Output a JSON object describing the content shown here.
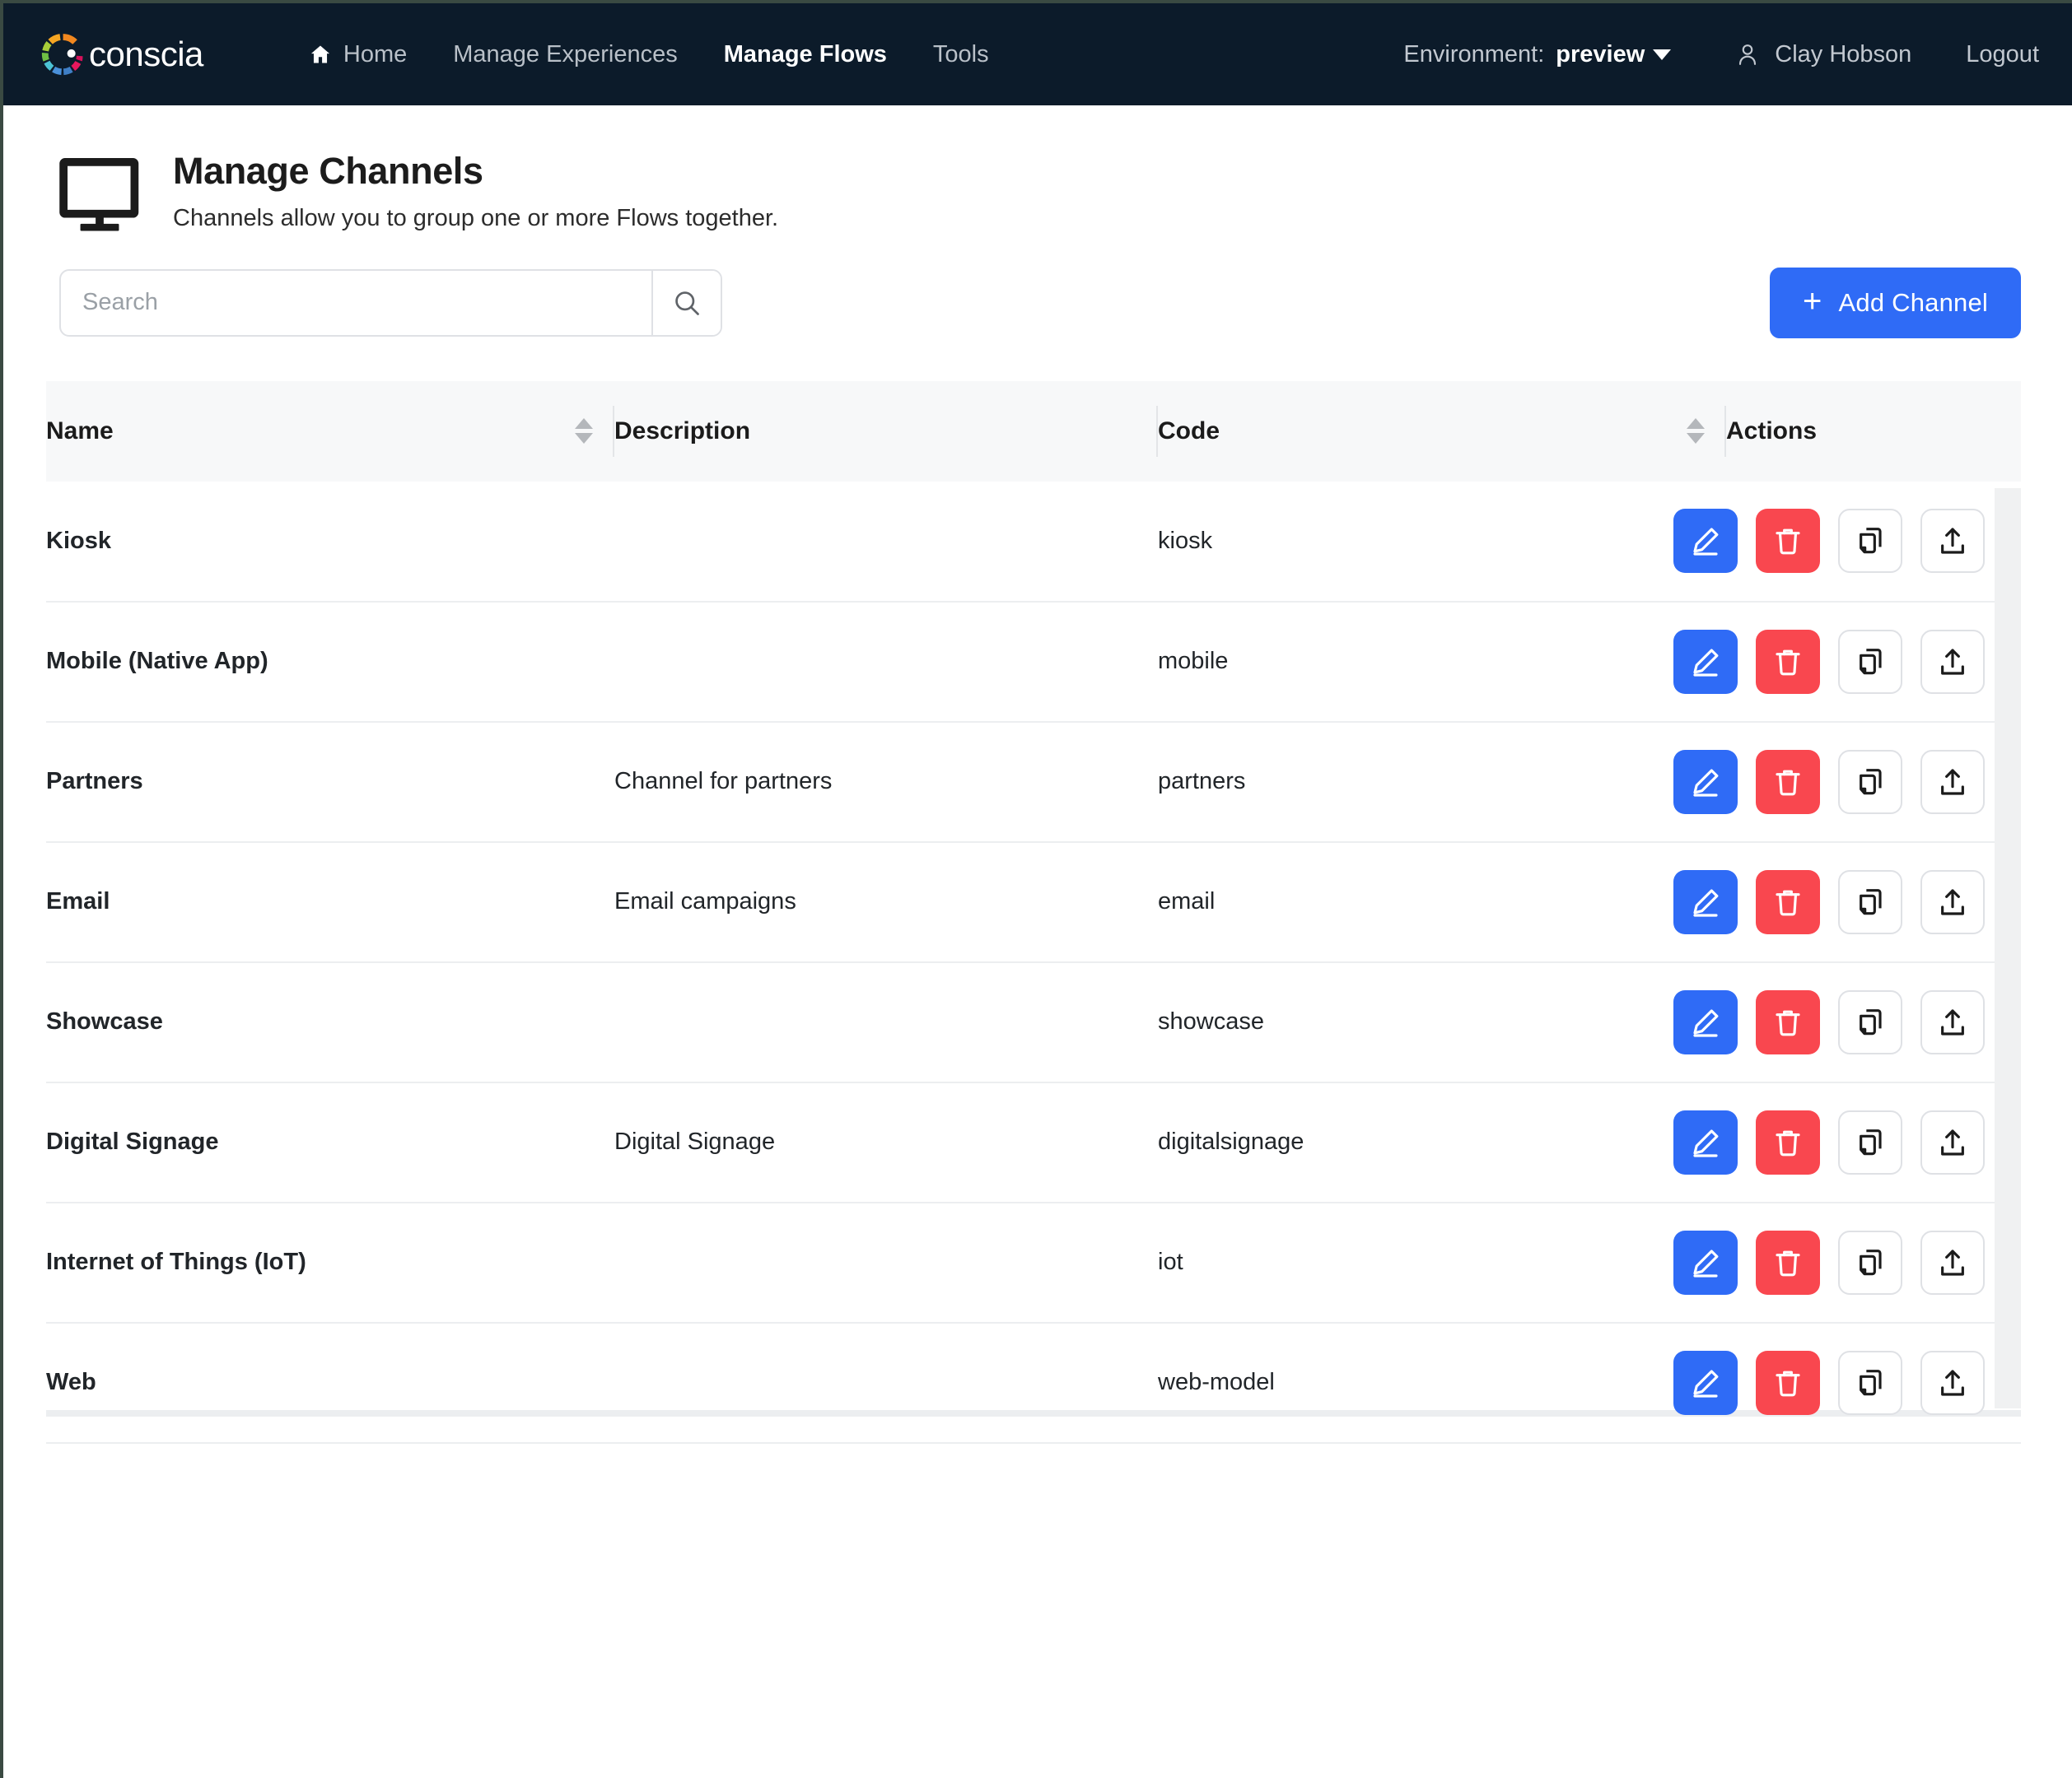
{
  "navbar": {
    "brand": "conscia",
    "links": [
      {
        "label": "Home",
        "icon": "home-icon",
        "active": false
      },
      {
        "label": "Manage Experiences",
        "icon": null,
        "active": false
      },
      {
        "label": "Manage Flows",
        "icon": null,
        "active": true
      },
      {
        "label": "Tools",
        "icon": null,
        "active": false
      }
    ],
    "environment_label": "Environment:",
    "environment_value": "preview",
    "user_name": "Clay Hobson",
    "logout_label": "Logout",
    "background": "#0c1b2a",
    "active_color": "#ffffff",
    "inactive_color": "#b9c0c8"
  },
  "header": {
    "icon": "monitor-icon",
    "title": "Manage Channels",
    "subtitle": "Channels allow you to group one or more Flows together."
  },
  "toolbar": {
    "search_placeholder": "Search",
    "search_value": "",
    "search_icon": "search-icon",
    "add_button_label": "Add Channel",
    "add_button_icon": "plus-icon",
    "accent_color": "#2f6bf6"
  },
  "table": {
    "columns": [
      {
        "key": "name",
        "label": "Name",
        "sortable": true
      },
      {
        "key": "description",
        "label": "Description",
        "sortable": false
      },
      {
        "key": "code",
        "label": "Code",
        "sortable": true
      },
      {
        "key": "actions",
        "label": "Actions",
        "sortable": false
      }
    ],
    "row_actions": [
      {
        "name": "edit-button",
        "icon": "pencil-icon",
        "color": "#2f6bf6"
      },
      {
        "name": "delete-button",
        "icon": "trash-icon",
        "color": "#f9474f"
      },
      {
        "name": "duplicate-button",
        "icon": "copy-icon",
        "color": "#ffffff"
      },
      {
        "name": "export-button",
        "icon": "upload-icon",
        "color": "#ffffff"
      }
    ],
    "rows": [
      {
        "name": "Kiosk",
        "description": "",
        "code": "kiosk"
      },
      {
        "name": "Mobile (Native App)",
        "description": "",
        "code": "mobile"
      },
      {
        "name": "Partners",
        "description": "Channel for partners",
        "code": "partners"
      },
      {
        "name": "Email",
        "description": "Email campaigns",
        "code": "email"
      },
      {
        "name": "Showcase",
        "description": "",
        "code": "showcase"
      },
      {
        "name": "Digital Signage",
        "description": "Digital Signage",
        "code": "digitalsignage"
      },
      {
        "name": "Internet of Things (IoT)",
        "description": "",
        "code": "iot"
      },
      {
        "name": "Web",
        "description": "",
        "code": "web-model"
      }
    ]
  }
}
